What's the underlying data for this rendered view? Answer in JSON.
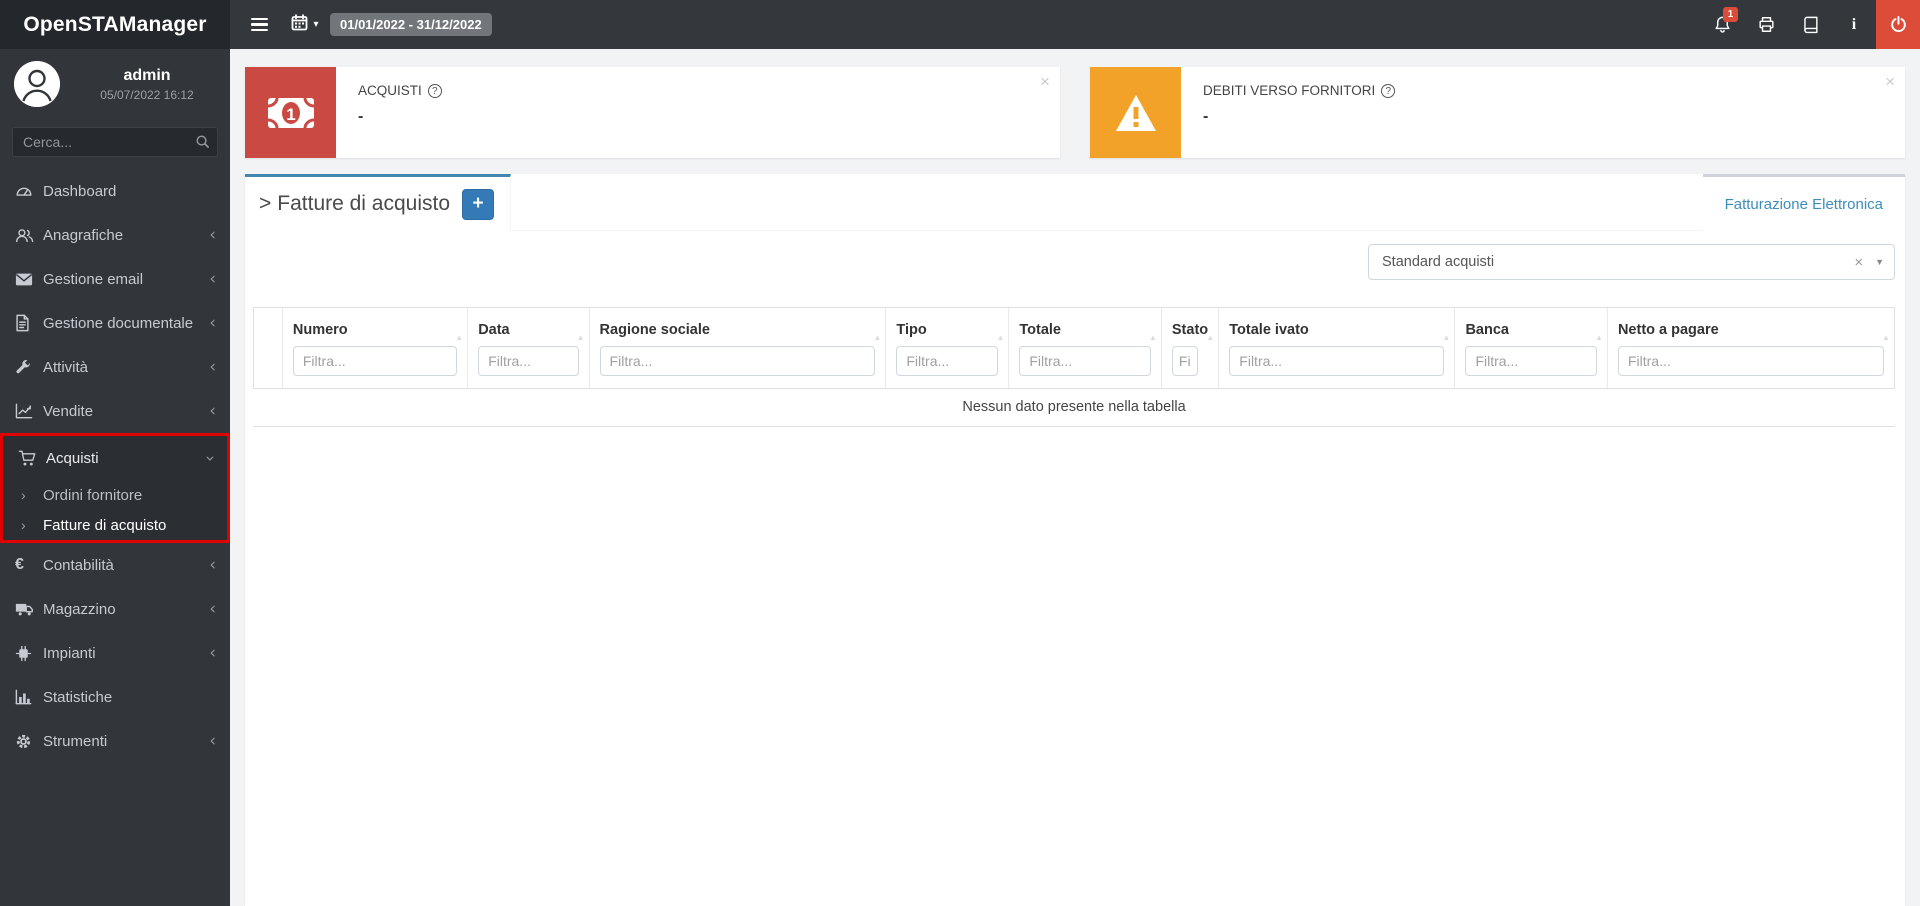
{
  "app": {
    "title": "OpenSTAManager"
  },
  "topbar": {
    "date_range": "01/01/2022 - 31/12/2022",
    "notification_count": "1",
    "caret": "▾"
  },
  "sidebar": {
    "user": {
      "name": "admin",
      "datetime": "05/07/2022 16:12"
    },
    "search_placeholder": "Cerca...",
    "items": [
      {
        "label": "Dashboard",
        "icon": "dashboard-icon"
      },
      {
        "label": "Anagrafiche",
        "icon": "users-icon"
      },
      {
        "label": "Gestione email",
        "icon": "envelope-icon"
      },
      {
        "label": "Gestione documentale",
        "icon": "document-icon"
      },
      {
        "label": "Attività",
        "icon": "wrench-icon"
      },
      {
        "label": "Vendite",
        "icon": "chart-line-icon"
      },
      {
        "label": "Acquisti",
        "icon": "cart-icon",
        "children": [
          "Ordini fornitore",
          "Fatture di acquisto"
        ]
      },
      {
        "label": "Contabilità",
        "icon": "euro-icon"
      },
      {
        "label": "Magazzino",
        "icon": "truck-icon"
      },
      {
        "label": "Impianti",
        "icon": "chip-icon"
      },
      {
        "label": "Statistiche",
        "icon": "bar-chart-icon"
      },
      {
        "label": "Strumenti",
        "icon": "gear-icon"
      }
    ],
    "chevron_collapsed": "‹",
    "chevron_expanded": "›",
    "sub_chevron": "›"
  },
  "widgets": [
    {
      "label": "ACQUISTI",
      "value": "-",
      "icon": "money-bill-icon",
      "color": "#ca4a43",
      "close": "×"
    },
    {
      "label": "DEBITI VERSO FORNITORI",
      "value": "-",
      "icon": "warning-icon",
      "color": "#f2a229",
      "close": "×"
    }
  ],
  "main": {
    "tab_title_prefix": ">",
    "tab_title": "Fatture di acquisto",
    "add_button": "+",
    "right_tab": "Fatturazione Elettronica",
    "filter_select": {
      "value": "Standard acquisti",
      "clear": "×",
      "caret": "▼"
    },
    "table": {
      "columns": [
        {
          "label": "",
          "filter": ""
        },
        {
          "label": "Numero",
          "filter": "Filtra..."
        },
        {
          "label": "Data",
          "filter": "Filtra..."
        },
        {
          "label": "Ragione sociale",
          "filter": "Filtra..."
        },
        {
          "label": "Tipo",
          "filter": "Filtra..."
        },
        {
          "label": "Totale",
          "filter": "Filtra..."
        },
        {
          "label": "Stato",
          "filter": "Filtra..."
        },
        {
          "label": "Totale ivato",
          "filter": "Filtra..."
        },
        {
          "label": "Banca",
          "filter": "Filtra..."
        },
        {
          "label": "Netto a pagare",
          "filter": "Filtra..."
        }
      ],
      "sort_glyph": "▲",
      "empty_message": "Nessun dato presente nella tabella"
    }
  },
  "colors": {
    "accent_blue": "#3c8dbc",
    "button_blue": "#337ab7",
    "danger_red": "#dd4b39",
    "annotation_red": "#e10000",
    "widget_red": "#ca4a43",
    "widget_orange": "#f2a229",
    "navbar_dark": "#34383d",
    "sidebar_dark": "#323539"
  }
}
